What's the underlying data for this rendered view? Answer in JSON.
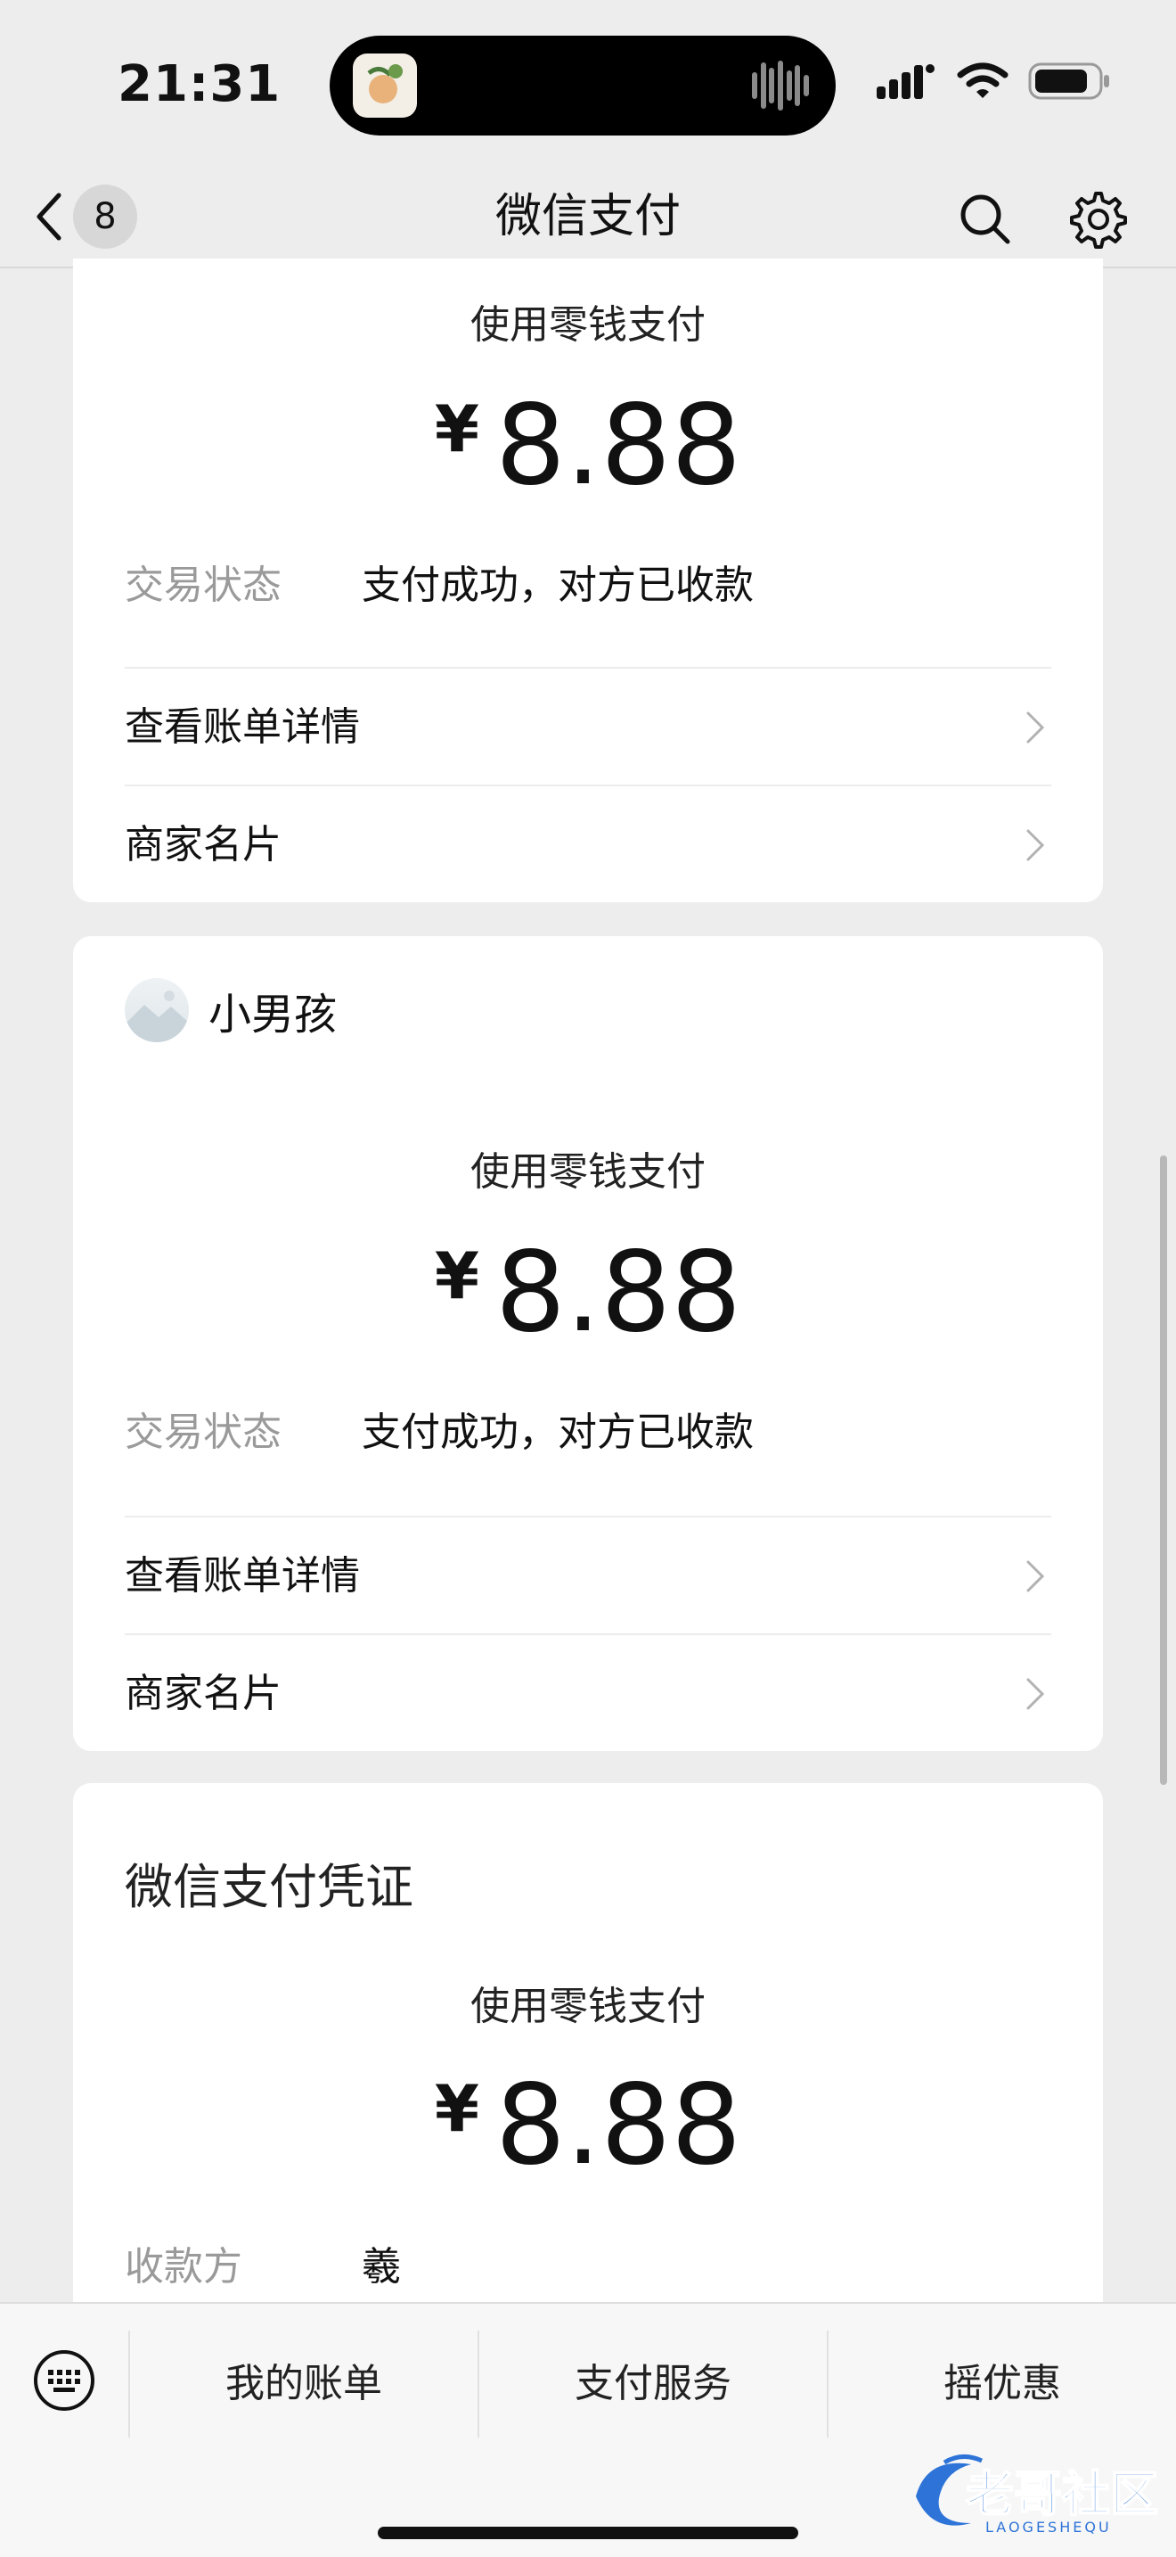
{
  "status_bar": {
    "time": "21:31"
  },
  "nav": {
    "back_count": "8",
    "title": "微信支付"
  },
  "cards": [
    {
      "pay_method": "使用零钱支付",
      "currency": "¥",
      "amount": "8.88",
      "status_key": "交易状态",
      "status_value": "支付成功，对方已收款",
      "rows": [
        "查看账单详情",
        "商家名片"
      ]
    },
    {
      "merchant_name": "小男孩",
      "pay_method": "使用零钱支付",
      "currency": "¥",
      "amount": "8.88",
      "status_key": "交易状态",
      "status_value": "支付成功，对方已收款",
      "rows": [
        "查看账单详情",
        "商家名片"
      ]
    },
    {
      "title": "微信支付凭证",
      "pay_method": "使用零钱支付",
      "currency": "¥",
      "amount": "8.88",
      "payee_key": "收款方",
      "payee_value": "羲"
    }
  ],
  "bottom_menu": [
    "我的账单",
    "支付服务",
    "摇优惠"
  ],
  "watermark": {
    "text": "老哥社区",
    "subtext": "LAOGESHEQU"
  },
  "colors": {
    "background": "#ededed",
    "card": "#ffffff",
    "muted": "#9a9a9a"
  }
}
